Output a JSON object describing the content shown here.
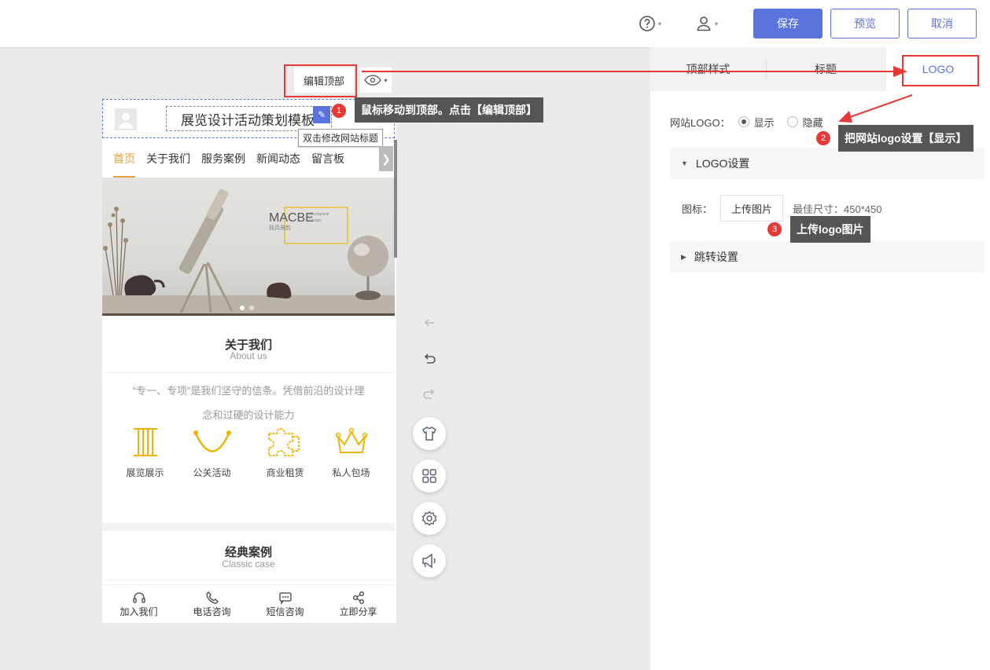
{
  "topbar": {
    "help_icon": "question-circle-icon",
    "user_icon": "user-icon",
    "save_label": "保存",
    "preview_label": "预览",
    "cancel_label": "取消"
  },
  "colors": {
    "accent": "#5b73dc",
    "annotation_red": "#e53935",
    "nav_active": "#e6a23c",
    "callout_bg": "#555555"
  },
  "editor": {
    "edit_top_label": "编辑顶部",
    "eye_icon": "eye-icon"
  },
  "phone": {
    "site_title": "展览设计活动策划模板",
    "title_tooltip": "双击修改网站标题",
    "nav": [
      "首页",
      "关于我们",
      "服务案例",
      "新闻动态",
      "留言板"
    ],
    "banner": {
      "brand": "MACBE",
      "brand_sub1": "Mechanical",
      "brand_sub2": "Design",
      "brand_cn": "独具雅韵"
    },
    "about": {
      "title": "关于我们",
      "subtitle": "About us",
      "text_line1": "“专一、专项”是我们坚守的信条。凭借前沿的设计理",
      "text_line2": "念和过硬的设计能力",
      "features": [
        "展览展示",
        "公关活动",
        "商业租赁",
        "私人包场"
      ]
    },
    "cases": {
      "title": "经典案例",
      "subtitle": "Classic case"
    },
    "bottom_bar": [
      "加入我们",
      "电话咨询",
      "短信咨询",
      "立即分享"
    ]
  },
  "right_panel": {
    "tabs": [
      "顶部样式",
      "标题",
      "LOGO"
    ],
    "logo_label": "网站LOGO：",
    "option_show": "显示",
    "option_hide": "隐藏",
    "logo_section": "LOGO设置",
    "icon_label": "图标：",
    "upload_label": "上传图片",
    "best_size": "最佳尺寸：450*450",
    "jump_section": "跳转设置"
  },
  "annotations": [
    {
      "num": "1",
      "text": "鼠标移动到顶部。点击【编辑顶部】"
    },
    {
      "num": "2",
      "text": "把网站logo设置【显示】"
    },
    {
      "num": "3",
      "text": "上传logo图片"
    }
  ]
}
